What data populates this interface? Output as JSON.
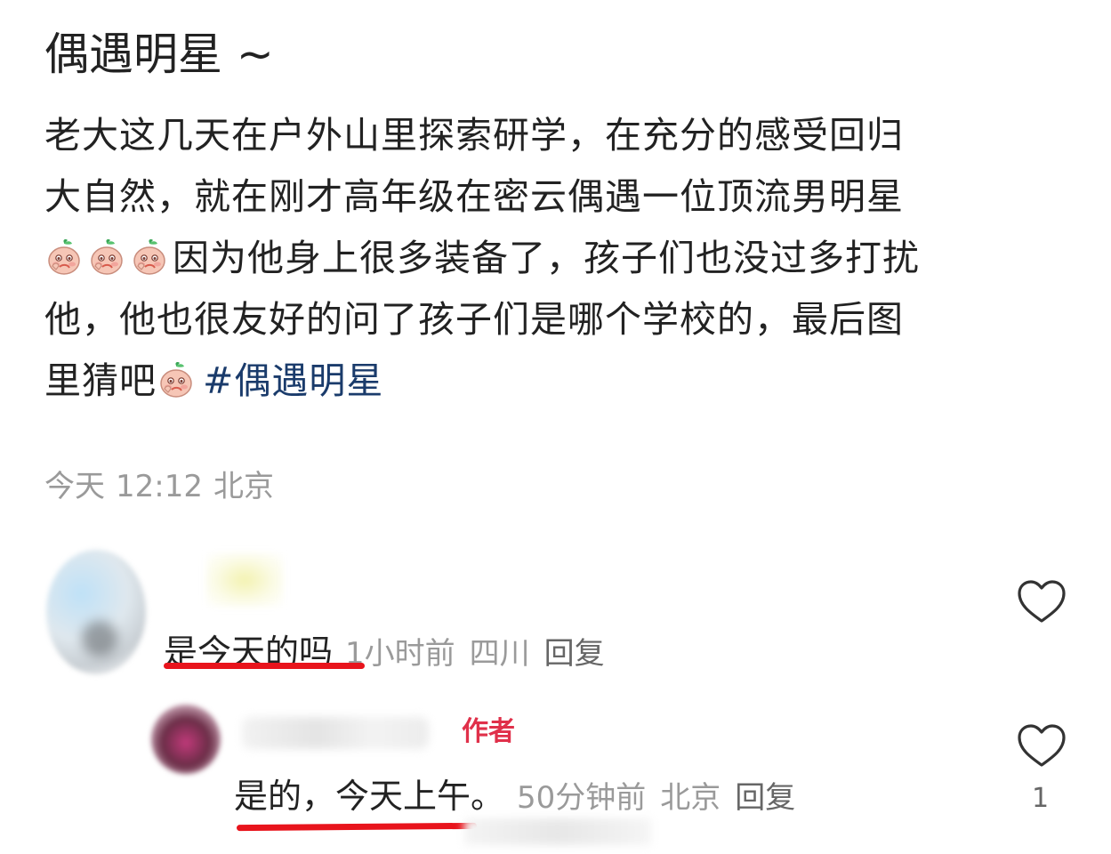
{
  "post": {
    "title": "偶遇明星 ~",
    "body_lines": [
      "老大这几天在户外山里探索研学，在充分的感受回归",
      "大自然，就在刚才高年级在密云偶遇一位顶流男明星",
      "因为他身上很多装备了，孩子们也没过多打扰",
      "他，他也很友好的问了孩子们是哪个学校的，最后图",
      "里猜吧"
    ],
    "hashtag": "#偶遇明星",
    "emoji_icon": "peach-face-icon"
  },
  "meta": {
    "day": "今天",
    "time": "12:12",
    "location": "北京"
  },
  "comments": [
    {
      "text": "是今天的吗",
      "time_ago": "1小时前",
      "location": "四川",
      "reply_label": "回复",
      "like_icon": "heart-outline-icon"
    },
    {
      "badge": "作者",
      "text": "是的，今天上午。",
      "time_ago": "50分钟前",
      "location": "北京",
      "reply_label": "回复",
      "like_icon": "heart-outline-icon",
      "like_count": "1"
    }
  ],
  "colors": {
    "text": "#222222",
    "meta": "#9a9a9a",
    "hashtag": "#1a3b6b",
    "author_badge": "#e0304a",
    "underline": "#e8141c"
  }
}
